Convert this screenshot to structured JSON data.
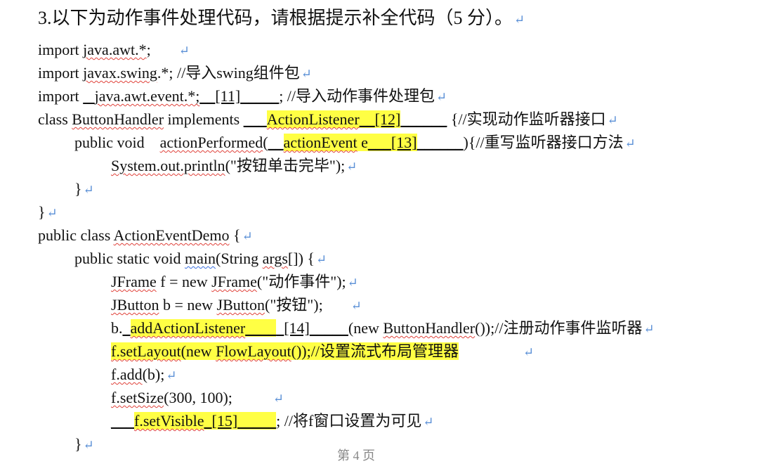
{
  "question": {
    "title": "3.以下为动作事件处理代码，请根据提示补全代码（5 分）。",
    "return_mark": "↵"
  },
  "code": {
    "l1": {
      "a": "import ",
      "b": "java.awt.*",
      "c": ";"
    },
    "l2": {
      "a": "import ",
      "b": "javax.swing",
      "c": ".*; //导入swing组件包"
    },
    "l3": {
      "a": "import ",
      "b1": "   ",
      "b2": "java.awt.event.*;",
      "b3": "__",
      "num": "[11]",
      "b4": "_____",
      "c": "; //导入动作事件处理包"
    },
    "l4": {
      "a": "class ",
      "b": "ButtonHandler",
      "c": " implements ",
      "d": "___",
      "e": "ActionListener",
      "f": "__",
      "num": "[12]",
      "g": "______",
      "h": " {//实现动作监听器接口"
    },
    "l5": {
      "a": "public void    ",
      "b": "actionPerformed",
      "c": "(",
      "d": "__",
      "e": "actionEvent",
      "f": " e",
      "g": "___",
      "num": "[13]",
      "h": "______",
      "i": "){//重写监听器接口方法"
    },
    "l6": {
      "a": "System.out.println",
      "b": "(\"按钮单击完毕\");"
    },
    "l7": {
      "a": "}"
    },
    "l8": {
      "a": "}"
    },
    "l9": {
      "a": "public class ",
      "b": "ActionEventDemo",
      "c": " {"
    },
    "l10": {
      "a": "public static void ",
      "b": "main",
      "c": "(String ",
      "d": "args",
      "e": "[]) {"
    },
    "l11": {
      "a": "JFrame",
      "b": " f = new ",
      "c": "JFrame",
      "d": "(\"动作事件\");"
    },
    "l12": {
      "a": "JButton",
      "b": " b = new ",
      "c": "JButton",
      "d": "(\"按钮\");"
    },
    "l13": {
      "a": "b.",
      "b": "_",
      "c": "addActionListener",
      "d": "____",
      "e": "_",
      "num": "[14]",
      "f": "_____",
      "g": "(new ",
      "h": "ButtonHandler",
      "i": "());//注册动作事件监听器"
    },
    "l14": {
      "a": "f.setLayout",
      "b": "(new ",
      "c": "FlowLayout",
      "d": "());//设置流式布局管理器"
    },
    "l15": {
      "a": "f.add",
      "b": "(b);"
    },
    "l16": {
      "a": "f.setSize",
      "b": "(300, 100);"
    },
    "l17": {
      "a": "___",
      "b": "f.setVisible",
      "c": "_",
      "num": "[15]",
      "d": "_____",
      "e": "; //将f窗口设置为可见"
    },
    "l18": {
      "a": "}"
    }
  },
  "footer": {
    "page_label": "第 4 页"
  },
  "colors": {
    "highlight": "#ffff44",
    "return_mark": "#5a8fd6",
    "spell_error": "#e0413a",
    "grammar_mark": "#3a6fe0"
  }
}
